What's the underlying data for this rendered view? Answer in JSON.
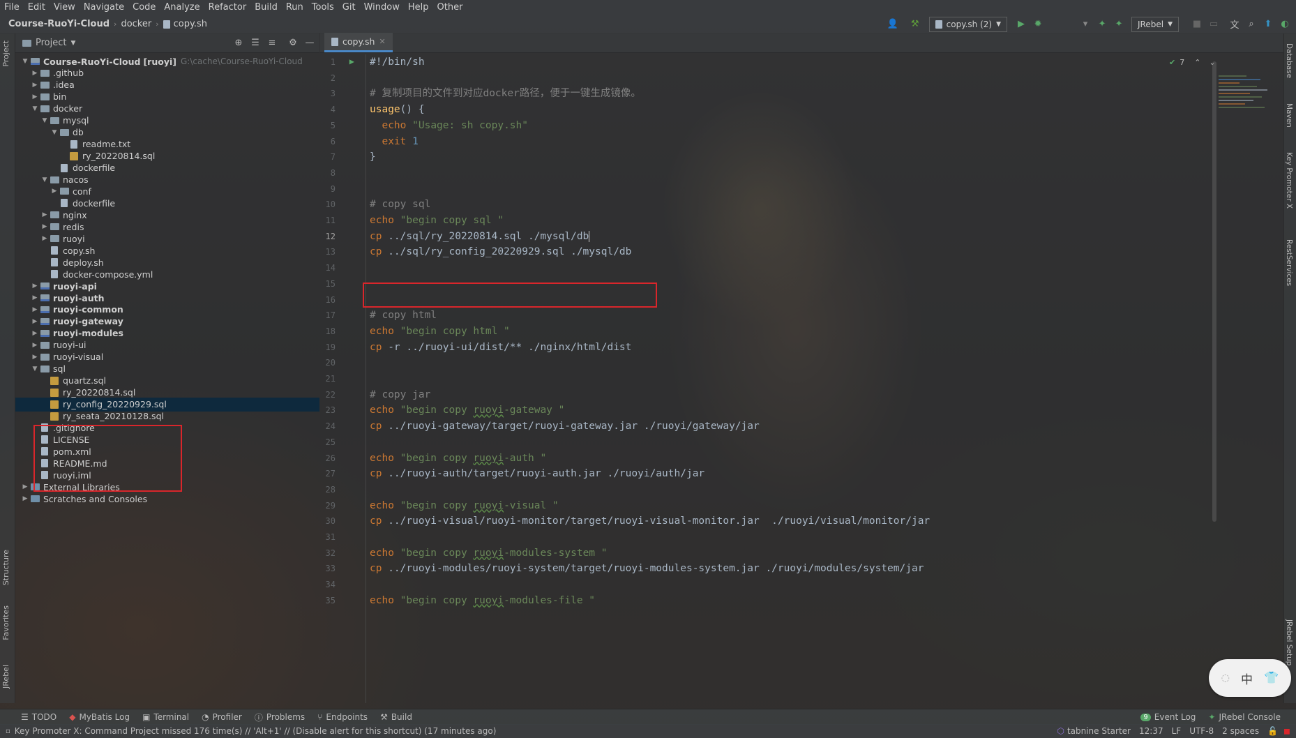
{
  "menu": [
    "File",
    "Edit",
    "View",
    "Navigate",
    "Code",
    "Analyze",
    "Refactor",
    "Build",
    "Run",
    "Tools",
    "Git",
    "Window",
    "Help",
    "Other"
  ],
  "breadcrumb": {
    "project": "Course-RuoYi-Cloud",
    "folder": "docker",
    "file": "copy.sh"
  },
  "toolbar": {
    "run_config": "copy.sh (2)",
    "jrebel": "JRebel"
  },
  "project_panel": {
    "title": "Project"
  },
  "tree": [
    {
      "label": "Course-RuoYi-Cloud",
      "extra": "[ruoyi]",
      "hint": "G:\\cache\\Course-RuoYi-Cloud",
      "indent": 0,
      "kind": "module",
      "open": true,
      "bold": true
    },
    {
      "label": ".github",
      "indent": 1,
      "kind": "folder",
      "open": false
    },
    {
      "label": ".idea",
      "indent": 1,
      "kind": "folder",
      "open": false
    },
    {
      "label": "bin",
      "indent": 1,
      "kind": "folder",
      "open": false
    },
    {
      "label": "docker",
      "indent": 1,
      "kind": "folder",
      "open": true
    },
    {
      "label": "mysql",
      "indent": 2,
      "kind": "folder",
      "open": true
    },
    {
      "label": "db",
      "indent": 3,
      "kind": "folder",
      "open": true
    },
    {
      "label": "readme.txt",
      "indent": 4,
      "kind": "file"
    },
    {
      "label": "ry_20220814.sql",
      "indent": 4,
      "kind": "sql"
    },
    {
      "label": "dockerfile",
      "indent": 3,
      "kind": "file"
    },
    {
      "label": "nacos",
      "indent": 2,
      "kind": "folder",
      "open": true
    },
    {
      "label": "conf",
      "indent": 3,
      "kind": "folder",
      "open": false
    },
    {
      "label": "dockerfile",
      "indent": 3,
      "kind": "file"
    },
    {
      "label": "nginx",
      "indent": 2,
      "kind": "folder",
      "open": false
    },
    {
      "label": "redis",
      "indent": 2,
      "kind": "folder",
      "open": false
    },
    {
      "label": "ruoyi",
      "indent": 2,
      "kind": "folder",
      "open": false
    },
    {
      "label": "copy.sh",
      "indent": 2,
      "kind": "file"
    },
    {
      "label": "deploy.sh",
      "indent": 2,
      "kind": "file"
    },
    {
      "label": "docker-compose.yml",
      "indent": 2,
      "kind": "file"
    },
    {
      "label": "ruoyi-api",
      "indent": 1,
      "kind": "module",
      "open": false,
      "bold": true
    },
    {
      "label": "ruoyi-auth",
      "indent": 1,
      "kind": "module",
      "open": false,
      "bold": true
    },
    {
      "label": "ruoyi-common",
      "indent": 1,
      "kind": "module",
      "open": false,
      "bold": true
    },
    {
      "label": "ruoyi-gateway",
      "indent": 1,
      "kind": "module",
      "open": false,
      "bold": true
    },
    {
      "label": "ruoyi-modules",
      "indent": 1,
      "kind": "module",
      "open": false,
      "bold": true
    },
    {
      "label": "ruoyi-ui",
      "indent": 1,
      "kind": "folder",
      "open": false
    },
    {
      "label": "ruoyi-visual",
      "indent": 1,
      "kind": "folder",
      "open": false
    },
    {
      "label": "sql",
      "indent": 1,
      "kind": "folder",
      "open": true
    },
    {
      "label": "quartz.sql",
      "indent": 2,
      "kind": "sql"
    },
    {
      "label": "ry_20220814.sql",
      "indent": 2,
      "kind": "sql"
    },
    {
      "label": "ry_config_20220929.sql",
      "indent": 2,
      "kind": "sql",
      "selected": true
    },
    {
      "label": "ry_seata_20210128.sql",
      "indent": 2,
      "kind": "sql"
    },
    {
      "label": ".gitignore",
      "indent": 1,
      "kind": "file"
    },
    {
      "label": "LICENSE",
      "indent": 1,
      "kind": "file"
    },
    {
      "label": "pom.xml",
      "indent": 1,
      "kind": "file"
    },
    {
      "label": "README.md",
      "indent": 1,
      "kind": "file"
    },
    {
      "label": "ruoyi.iml",
      "indent": 1,
      "kind": "file"
    },
    {
      "label": "External Libraries",
      "indent": 0,
      "kind": "lib",
      "open": false
    },
    {
      "label": "Scratches and Consoles",
      "indent": 0,
      "kind": "lib",
      "open": false
    }
  ],
  "editor": {
    "tab": "copy.sh",
    "inspection_count": "7",
    "current_line": 12,
    "lines": [
      [
        {
          "t": "#!/bin/sh",
          "c": "code"
        }
      ],
      [],
      [
        {
          "t": "# 复制项目的文件到对应docker路径，便于一键生成镜像。",
          "c": "cmt"
        }
      ],
      [
        {
          "t": "usage",
          "c": "fn"
        },
        {
          "t": "() {",
          "c": "code"
        }
      ],
      [
        {
          "t": "  ",
          "c": "code"
        },
        {
          "t": "echo ",
          "c": "kw"
        },
        {
          "t": "\"Usage: sh copy.sh\"",
          "c": "str"
        }
      ],
      [
        {
          "t": "  ",
          "c": "code"
        },
        {
          "t": "exit ",
          "c": "kw"
        },
        {
          "t": "1",
          "c": "num"
        }
      ],
      [
        {
          "t": "}",
          "c": "code"
        }
      ],
      [],
      [],
      [
        {
          "t": "# copy sql",
          "c": "cmt"
        }
      ],
      [
        {
          "t": "echo ",
          "c": "kw"
        },
        {
          "t": "\"begin copy sql \"",
          "c": "str"
        }
      ],
      [
        {
          "t": "cp ",
          "c": "kw"
        },
        {
          "t": "../sql/ry_20220814.sql ./mysql/db",
          "c": "code"
        }
      ],
      [
        {
          "t": "cp ",
          "c": "kw"
        },
        {
          "t": "../sql/ry_config_20220929.sql ./mysql/db",
          "c": "code"
        }
      ],
      [],
      [],
      [],
      [
        {
          "t": "# copy html",
          "c": "cmt"
        }
      ],
      [
        {
          "t": "echo ",
          "c": "kw"
        },
        {
          "t": "\"begin copy html \"",
          "c": "str"
        }
      ],
      [
        {
          "t": "cp ",
          "c": "kw"
        },
        {
          "t": "-r ../ruoyi-ui/dist/** ./nginx/html/dist",
          "c": "code"
        }
      ],
      [],
      [],
      [
        {
          "t": "# copy jar",
          "c": "cmt"
        }
      ],
      [
        {
          "t": "echo ",
          "c": "kw"
        },
        {
          "t": "\"begin copy ",
          "c": "str"
        },
        {
          "t": "ruoyi",
          "c": "str typo"
        },
        {
          "t": "-gateway \"",
          "c": "str"
        }
      ],
      [
        {
          "t": "cp ",
          "c": "kw"
        },
        {
          "t": "../ruoyi-gateway/target/ruoyi-gateway.jar ./ruoyi/gateway/jar",
          "c": "code"
        }
      ],
      [],
      [
        {
          "t": "echo ",
          "c": "kw"
        },
        {
          "t": "\"begin copy ",
          "c": "str"
        },
        {
          "t": "ruoyi",
          "c": "str typo"
        },
        {
          "t": "-auth \"",
          "c": "str"
        }
      ],
      [
        {
          "t": "cp ",
          "c": "kw"
        },
        {
          "t": "../ruoyi-auth/target/ruoyi-auth.jar ./ruoyi/auth/jar",
          "c": "code"
        }
      ],
      [],
      [
        {
          "t": "echo ",
          "c": "kw"
        },
        {
          "t": "\"begin copy ",
          "c": "str"
        },
        {
          "t": "ruoyi",
          "c": "str typo"
        },
        {
          "t": "-visual \"",
          "c": "str"
        }
      ],
      [
        {
          "t": "cp ",
          "c": "kw"
        },
        {
          "t": "../ruoyi-visual/ruoyi-monitor/target/ruoyi-visual-monitor.jar  ./ruoyi/visual/monitor/jar",
          "c": "code"
        }
      ],
      [],
      [
        {
          "t": "echo ",
          "c": "kw"
        },
        {
          "t": "\"begin copy ",
          "c": "str"
        },
        {
          "t": "ruoyi",
          "c": "str typo"
        },
        {
          "t": "-modules-system \"",
          "c": "str"
        }
      ],
      [
        {
          "t": "cp ",
          "c": "kw"
        },
        {
          "t": "../ruoyi-modules/ruoyi-system/target/ruoyi-modules-system.jar ./ruoyi/modules/system/jar",
          "c": "code"
        }
      ],
      [],
      [
        {
          "t": "echo ",
          "c": "kw"
        },
        {
          "t": "\"begin copy ",
          "c": "str"
        },
        {
          "t": "ruoyi",
          "c": "str typo"
        },
        {
          "t": "-modules-file \"",
          "c": "str"
        }
      ]
    ]
  },
  "left_tabs": [
    "Project",
    "Structure",
    "Favorites",
    "JRebel"
  ],
  "right_tabs": [
    "Database",
    "Maven",
    "Key Promoter X",
    "RestServices",
    "JRebel Setup"
  ],
  "bottom_tools": [
    "TODO",
    "MyBatis Log",
    "Terminal",
    "Profiler",
    "Problems",
    "Endpoints",
    "Build"
  ],
  "bottom_right_tools": {
    "event_log": "Event Log",
    "event_count": "9",
    "jrebel_console": "JRebel Console"
  },
  "status": {
    "message": "Key Promoter X: Command Project missed 176 time(s) // 'Alt+1' // (Disable alert for this shortcut) (17 minutes ago)",
    "tabnine": "tabnine Starter",
    "position": "12:37",
    "line_sep": "LF",
    "encoding": "UTF-8",
    "indent": "2 spaces"
  },
  "ime": {
    "lang": "中"
  },
  "colors": {
    "accent": "#4a88c7",
    "highlight_box": "#d9262b",
    "selection": "#0d293e"
  }
}
